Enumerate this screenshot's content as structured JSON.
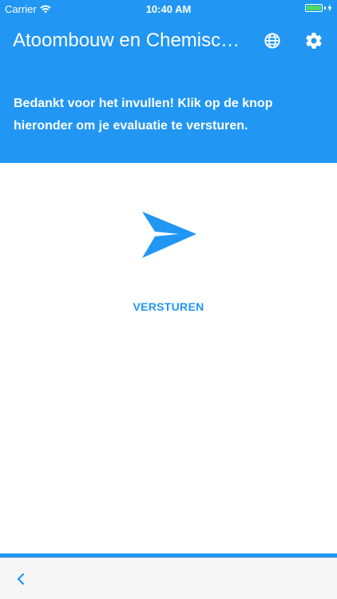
{
  "status_bar": {
    "carrier": "Carrier",
    "time": "10:40 AM",
    "battery_level": 1.0,
    "battery_color": "#4cd964",
    "charging": true
  },
  "toolbar": {
    "title": "Atoombouw en Chemische bindingen",
    "title_display": "Atoombouw en Chemisc…",
    "language_icon": "globe-icon",
    "settings_icon": "gear-icon"
  },
  "main": {
    "message": "Bedankt voor het invullen! Klik op de knop hieronder om je evaluatie te versturen.",
    "send_icon": "send-icon",
    "send_label": "VERSTUREN"
  },
  "bottom_bar": {
    "back_icon": "chevron-left-icon"
  },
  "colors": {
    "primary": "#2196f3",
    "header_text": "#ffffff",
    "bottom_bar": "#f6f6f7"
  }
}
